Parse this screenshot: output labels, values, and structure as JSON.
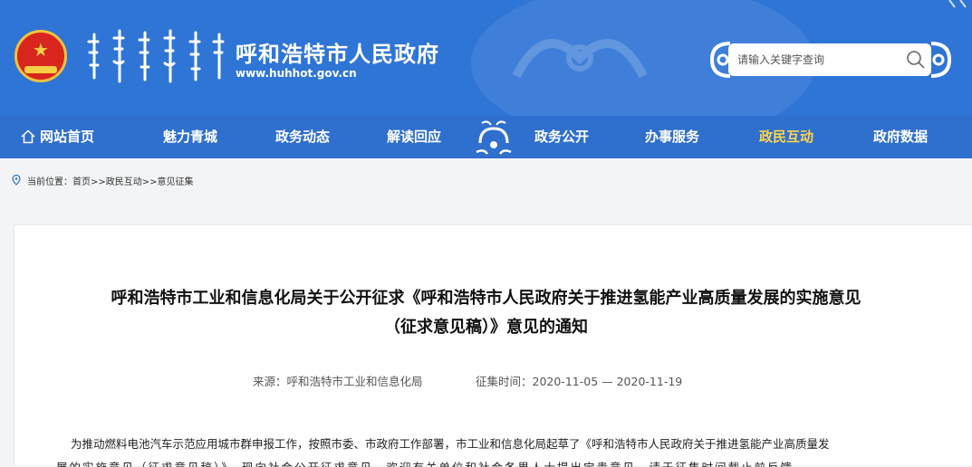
{
  "header": {
    "title": "呼和浩特市人民政府",
    "url": "www.huhhot.gov.cn"
  },
  "search": {
    "placeholder": "请输入关键字查询"
  },
  "nav": {
    "items": [
      {
        "label": "网站首页"
      },
      {
        "label": "魅力青城"
      },
      {
        "label": "政务动态"
      },
      {
        "label": "解读回应"
      },
      {
        "label": "政务公开"
      },
      {
        "label": "办事服务"
      },
      {
        "label": "政民互动",
        "active": true
      },
      {
        "label": "政府数据"
      }
    ]
  },
  "breadcrumb": {
    "text": "当前位置：首页>>政民互动>>意见征集"
  },
  "article": {
    "title_line1": "呼和浩特市工业和信息化局关于公开征求《呼和浩特市人民政府关于推进氢能产业高质量发展的实施意见",
    "title_line2": "（征求意见稿）》意见的通知",
    "source": "来源：呼和浩特市工业和信息化局",
    "period": "征集时间：2020-11-05 — 2020-11-19",
    "body_line1": "为推动燃料电池汽车示范应用城市群申报工作，按照市委、市政府工作部署，市工业和信息化局起草了《呼和浩特市人民政府关于推进氢能产业高质量发",
    "body_line2": "展的实施意见（征求意见稿）》，现向社会公开征求意见。欢迎有关单位和社会各界人士提出宝贵意见，请于征集时间截止前反馈。"
  },
  "colors": {
    "header_blue": "#2f75d6",
    "nav_blue": "#2f6fce",
    "active_nav": "#ffd548",
    "emblem_red": "#d8261f"
  }
}
